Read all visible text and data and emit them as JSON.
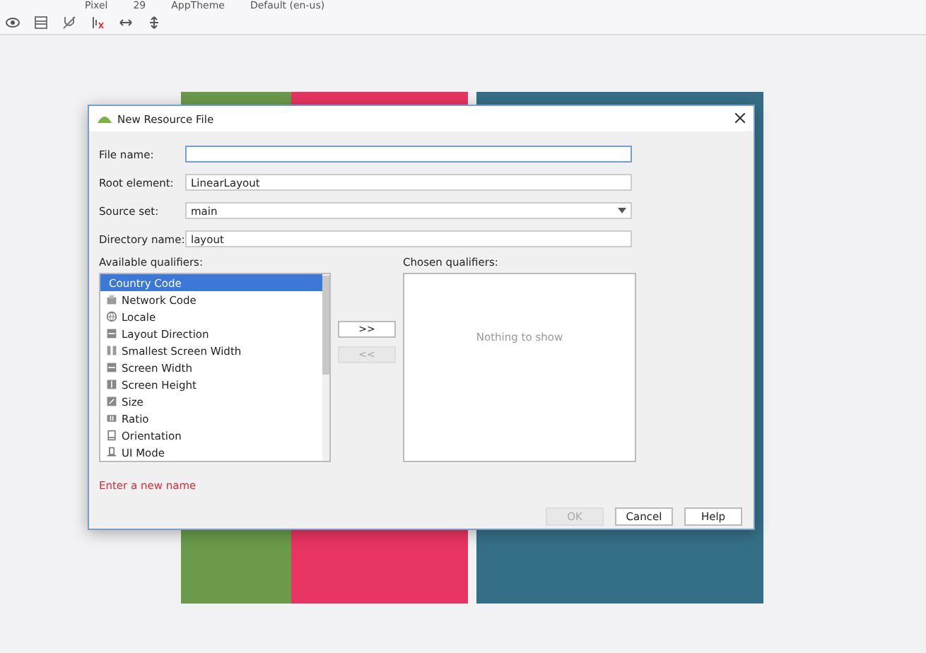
{
  "toolbar": {
    "items": [
      "Pixel",
      "29",
      "AppTheme",
      "Default (en-us)"
    ]
  },
  "dialog": {
    "title": "New Resource File",
    "fields": [
      {
        "kind": "text",
        "label": "File name:"
      },
      {
        "kind": "text",
        "label": "Root element:",
        "value": "LinearLayout"
      },
      {
        "kind": "dropdown",
        "label": "Source set:",
        "value": "main"
      },
      {
        "kind": "text",
        "label": "Directory name:",
        "value": "layout"
      }
    ],
    "available_qualifiers": {
      "label": "Available qualifiers:",
      "items": [
        {
          "label": "Country Code",
          "selected": true
        },
        {
          "label": "Network Code",
          "selected": false
        },
        {
          "label": "Locale",
          "selected": false
        },
        {
          "label": "Layout Direction",
          "selected": false
        },
        {
          "label": "Smallest Screen Width",
          "selected": false
        },
        {
          "label": "Screen Width",
          "selected": false
        },
        {
          "label": "Screen Height",
          "selected": false
        },
        {
          "label": "Size",
          "selected": false
        },
        {
          "label": "Ratio",
          "selected": false
        },
        {
          "label": "Orientation",
          "selected": false
        },
        {
          "label": "UI Mode",
          "selected": false
        }
      ]
    },
    "move_buttons": [
      {
        "label": ">>",
        "disabled": false
      },
      {
        "label": "<<",
        "disabled": true
      }
    ],
    "chosen_qualifiers": {
      "label": "Chosen qualifiers:",
      "empty_text": "Nothing to show"
    },
    "error": "Enter a new name",
    "buttons": [
      {
        "label": "OK",
        "disabled": true
      },
      {
        "label": "Cancel",
        "disabled": false
      },
      {
        "label": "Help",
        "disabled": false
      }
    ]
  }
}
